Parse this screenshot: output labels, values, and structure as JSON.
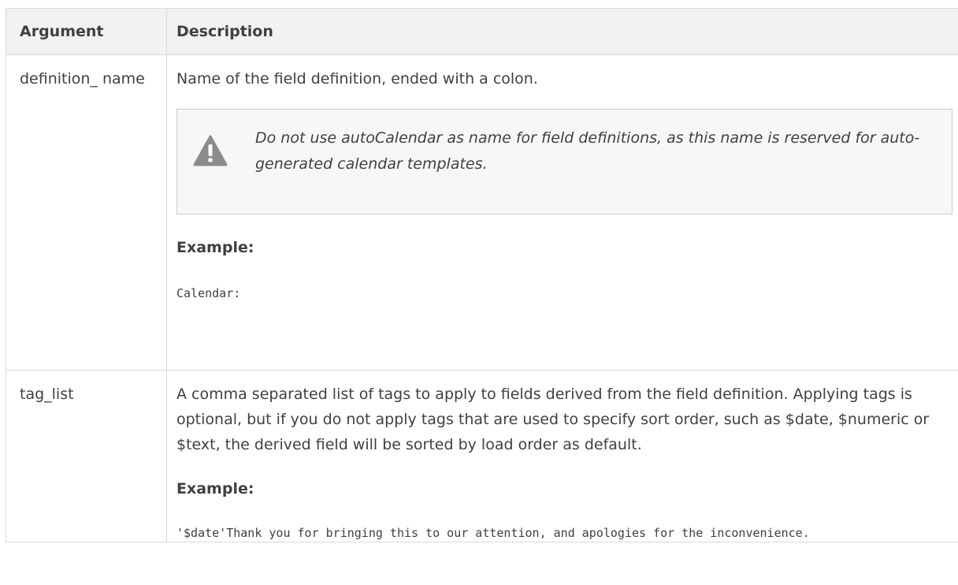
{
  "table": {
    "headers": {
      "argument": "Argument",
      "description": "Description"
    },
    "rows": [
      {
        "argument": "definition_ name",
        "description": "Name of the field definition, ended with a colon.",
        "warning": "Do not use autoCalendar as name for field definitions, as this name is reserved for auto-generated calendar templates.",
        "example_heading": "Example:",
        "example_code": "Calendar:"
      },
      {
        "argument": "tag_list",
        "description": "A comma separated list of tags to apply to fields derived from the field definition. Applying tags is optional, but if you do not apply tags that are used to specify sort order, such as $date, $numeric or $text, the derived field will be sorted by load order as default.",
        "example_heading": "Example:",
        "example_code": "'$date'Thank you for bringing this to our attention, and apologies for the inconvenience."
      }
    ]
  },
  "icons": {
    "warning": "warning-triangle-icon"
  },
  "colors": {
    "header_background": "#f2f2f2",
    "border": "#d9d9d9",
    "warning_background": "#f7f7f7",
    "warning_icon": "#8c8c8c",
    "text": "#404040"
  }
}
